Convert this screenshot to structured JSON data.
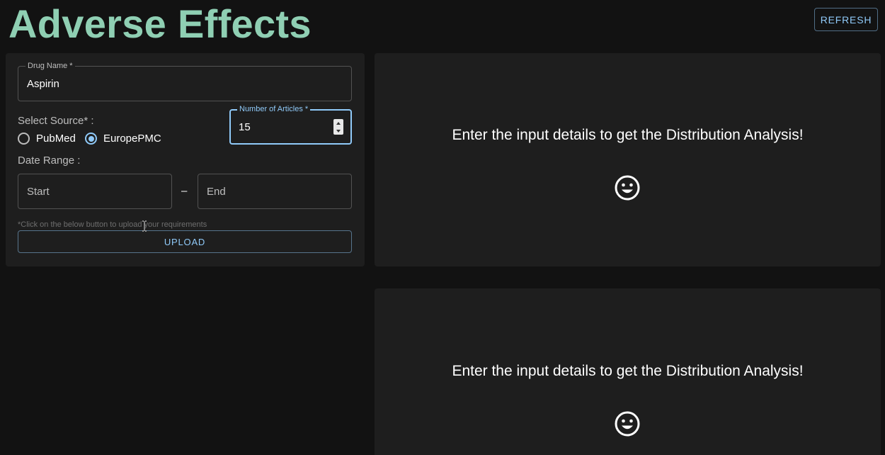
{
  "header": {
    "title": "Adverse Effects",
    "refresh_label": "REFRESH"
  },
  "form": {
    "drug_name": {
      "label": "Drug Name *",
      "value": "Aspirin"
    },
    "num_articles": {
      "label": "Number of Articles *",
      "value": "15"
    },
    "source": {
      "label": "Select Source* :",
      "options": [
        {
          "label": "PubMed",
          "selected": false
        },
        {
          "label": "EuropePMC",
          "selected": true
        }
      ]
    },
    "date_range": {
      "label": "Date Range :",
      "start_placeholder": "Start",
      "separator": "–",
      "end_placeholder": "End"
    },
    "hint": "*Click on the below button to upload your requirements",
    "upload_label": "UPLOAD"
  },
  "results": [
    {
      "message": "Enter the input details to get the Distribution Analysis!",
      "icon": "smiley-icon"
    },
    {
      "message": "Enter the input details to get the Distribution Analysis!",
      "icon": "smiley-icon"
    }
  ],
  "colors": {
    "title": "#8fcfb3",
    "accent": "#90caf9",
    "background": "#121212",
    "panel": "#1e1e1e"
  }
}
